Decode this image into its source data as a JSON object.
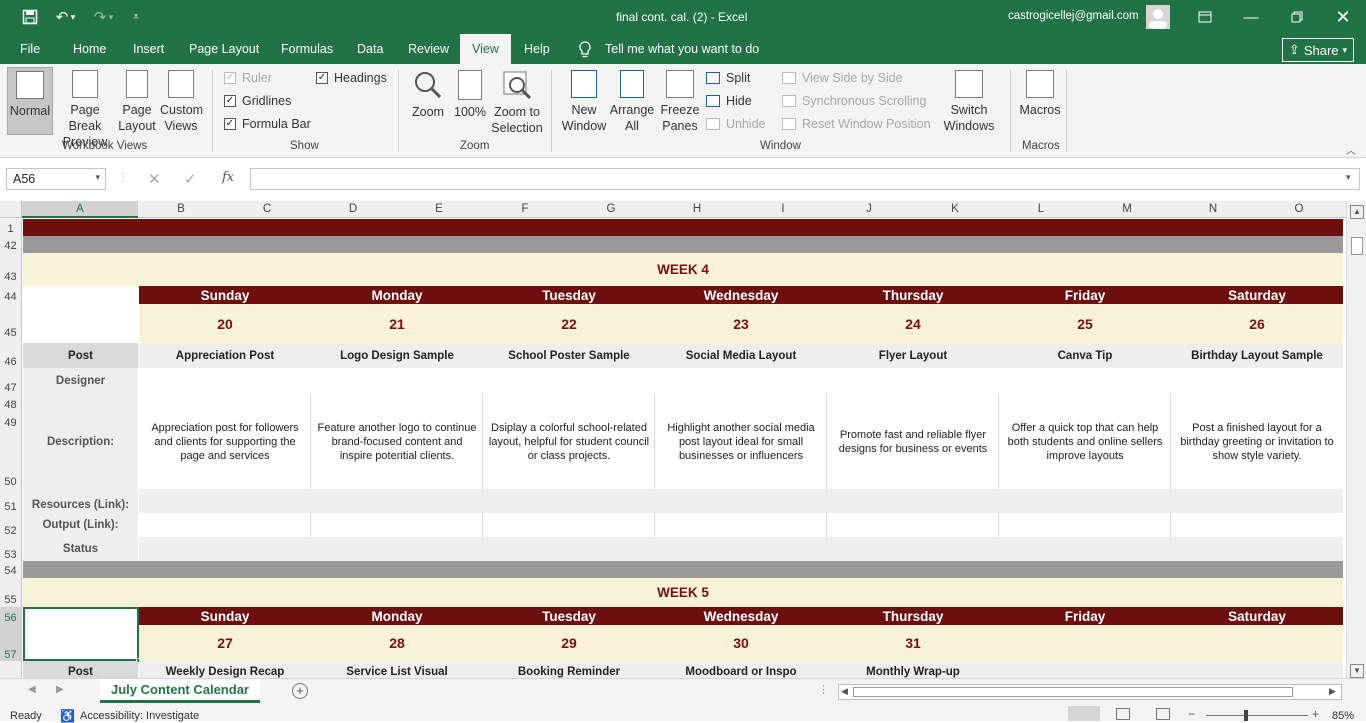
{
  "window": {
    "title": "final cont. cal. (2)  -  Excel",
    "account": "castrogicellej@gmail.com"
  },
  "tabs": [
    "File",
    "Home",
    "Insert",
    "Page Layout",
    "Formulas",
    "Data",
    "Review",
    "View",
    "Help"
  ],
  "tell_me": "Tell me what you want to do",
  "share_label": "Share",
  "ribbon": {
    "workbook_views": {
      "label": "Workbook Views",
      "normal": "Normal",
      "page_break": "Page Break Preview",
      "page_layout": "Page Layout",
      "custom_views": "Custom Views"
    },
    "show": {
      "label": "Show",
      "ruler": "Ruler",
      "gridlines": "Gridlines",
      "formula_bar": "Formula Bar",
      "headings": "Headings"
    },
    "zoom": {
      "label": "Zoom",
      "zoom": "Zoom",
      "hundred": "100%",
      "zoom_selection": "Zoom to Selection"
    },
    "window": {
      "label": "Window",
      "new_window": "New Window",
      "arrange_all": "Arrange All",
      "freeze_panes": "Freeze Panes",
      "split": "Split",
      "hide": "Hide",
      "unhide": "Unhide",
      "view_side": "View Side by Side",
      "sync_scroll": "Synchronous Scrolling",
      "reset_pos": "Reset Window Position",
      "switch": "Switch Windows"
    },
    "macros": {
      "label": "Macros",
      "macros": "Macros"
    }
  },
  "formula_bar": {
    "name_box": "A56",
    "fx": "fx",
    "value": ""
  },
  "columns": [
    "A",
    "B",
    "C",
    "D",
    "E",
    "F",
    "G",
    "H",
    "I",
    "J",
    "K",
    "L",
    "M",
    "N",
    "O"
  ],
  "rows": {
    "r1": "1",
    "r42": "42",
    "r43": "43",
    "r44": "44",
    "r45": "45",
    "r46": "46",
    "r47": "47",
    "r48": "48",
    "r49": "49",
    "r50": "50",
    "r51": "51",
    "r52": "52",
    "r53": "53",
    "r54": "54",
    "r55": "55",
    "r56": "56",
    "r57": "57"
  },
  "days": [
    "Sunday",
    "Monday",
    "Tuesday",
    "Wednesday",
    "Thursday",
    "Friday",
    "Saturday"
  ],
  "labels": {
    "post": "Post",
    "designer": "Designer",
    "description": "Description:",
    "resources": "Resources (Link):",
    "output": "Output (Link):",
    "status": "Status"
  },
  "week4": {
    "title": "WEEK 4",
    "dates": [
      "20",
      "21",
      "22",
      "23",
      "24",
      "25",
      "26"
    ],
    "posts": [
      "Appreciation Post",
      "Logo Design Sample",
      "School Poster Sample",
      "Social Media Layout",
      "Flyer Layout",
      "Canva Tip",
      "Birthday Layout Sample"
    ],
    "descriptions": [
      "Appreciation post for followers and clients for supporting the page and services",
      "Feature another logo to continue brand-focused content and inspire potential clients.",
      "Dsiplay a colorful school-related layout, helpful for student council or class projects.",
      "Highlight another social media post layout ideal for small businesses or influencers",
      "Promote fast and reliable flyer designs for business or events",
      "Offer a quick top that can help both students and online sellers improve layouts",
      "Post a finished layout for a birthday greeting or invitation to show style variety."
    ]
  },
  "week5": {
    "title": "WEEK 5",
    "dates": [
      "27",
      "28",
      "29",
      "30",
      "31"
    ],
    "posts": [
      "Weekly Design Recap",
      "Service List Visual",
      "Booking Reminder",
      "Moodboard or Inspo",
      "Monthly Wrap-up"
    ]
  },
  "sheet_tab": "July Content Calendar",
  "status": {
    "ready": "Ready",
    "accessibility": "Accessibility: Investigate",
    "zoom": "85%"
  }
}
